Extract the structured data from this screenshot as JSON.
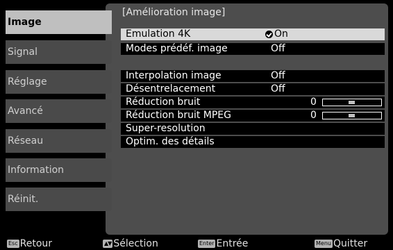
{
  "sidebar": {
    "items": [
      {
        "label": "Image",
        "active": true
      },
      {
        "label": "Signal",
        "active": false
      },
      {
        "label": "Réglage",
        "active": false
      },
      {
        "label": "Avancé",
        "active": false
      },
      {
        "label": "Réseau",
        "active": false
      },
      {
        "label": "Information",
        "active": false
      },
      {
        "label": "Réinit.",
        "active": false
      }
    ]
  },
  "panel": {
    "title": "[Amélioration image]",
    "rows": [
      {
        "label": "Emulation 4K",
        "value": "On",
        "selected": true
      },
      {
        "label": "Modes prédéf. image",
        "value": "Off"
      },
      {
        "label": "Interpolation image",
        "value": "Off"
      },
      {
        "label": "Désentrelacement",
        "value": "Off"
      },
      {
        "label": "Réduction bruit",
        "value": "0",
        "slider_level": 0.5
      },
      {
        "label": "Réduction bruit MPEG",
        "value": "0",
        "slider_level": 0.5
      },
      {
        "label": "Super-resolution",
        "value": ""
      },
      {
        "label": "Optim. des détails",
        "value": ""
      }
    ]
  },
  "footer": {
    "back": {
      "key": "Esc",
      "label": "Retour"
    },
    "select": {
      "key": "▲▼",
      "label": "Sélection"
    },
    "enter": {
      "key": "Enter",
      "label": "Entrée"
    },
    "quit": {
      "key": "Menu",
      "label": "Quitter"
    }
  },
  "colors": {
    "panel_bg": "#4d4d4d",
    "active_tab": "#bfbfbf",
    "inactive_tab": "#4a4a4a",
    "highlight_row": "#d9d9d9"
  }
}
